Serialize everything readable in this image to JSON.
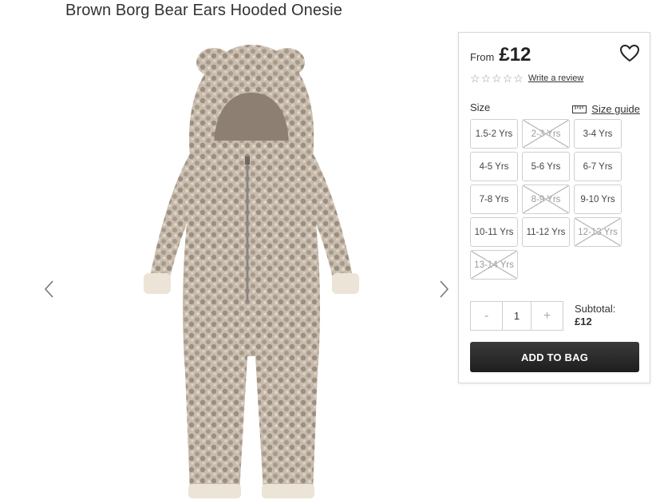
{
  "product": {
    "title": "Brown Borg Bear Ears Hooded Onesie"
  },
  "gallery": {
    "prev_icon": "chevron-left-icon",
    "next_icon": "chevron-right-icon"
  },
  "panel": {
    "price_prefix": "From",
    "price": "£12",
    "wishlist_icon": "heart-outline-icon",
    "rating": {
      "stars": 0,
      "max_stars": 5,
      "review_link": "Write a review"
    },
    "size_label": "Size",
    "size_guide_label": "Size guide",
    "size_guide_icon": "ruler-icon",
    "sizes": [
      {
        "label": "1.5-2 Yrs",
        "available": true
      },
      {
        "label": "2-3 Yrs",
        "available": false
      },
      {
        "label": "3-4 Yrs",
        "available": true
      },
      {
        "label": "4-5 Yrs",
        "available": true
      },
      {
        "label": "5-6 Yrs",
        "available": true
      },
      {
        "label": "6-7 Yrs",
        "available": true
      },
      {
        "label": "7-8 Yrs",
        "available": true
      },
      {
        "label": "8-9 Yrs",
        "available": false
      },
      {
        "label": "9-10 Yrs",
        "available": true
      },
      {
        "label": "10-11 Yrs",
        "available": true
      },
      {
        "label": "11-12 Yrs",
        "available": true
      },
      {
        "label": "12-13 Yrs",
        "available": false
      },
      {
        "label": "13-14 Yrs",
        "available": false
      }
    ],
    "quantity": {
      "decrement": "-",
      "value": "1",
      "increment": "+"
    },
    "subtotal_label": "Subtotal:",
    "subtotal_value": "£12",
    "add_to_bag": "ADD TO BAG"
  },
  "colors": {
    "button_dark": "#2b2b2b",
    "border": "#cfcfcf",
    "fabric": "#b9ab9c"
  }
}
